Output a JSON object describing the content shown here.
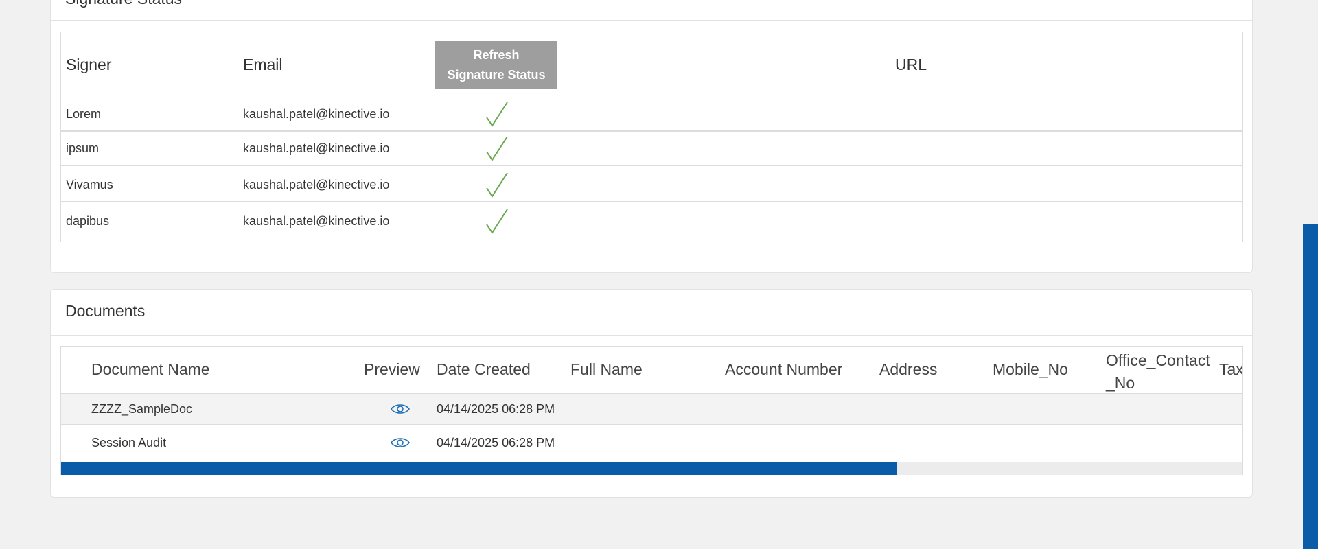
{
  "signature_status": {
    "title": "Signature Status",
    "headers": {
      "signer": "Signer",
      "email": "Email",
      "refresh_button": "Refresh\nSignature Status",
      "url": "URL"
    },
    "rows": [
      {
        "signer": "Lorem",
        "email": "kaushal.patel@kinective.io",
        "status_icon": "checkmark-icon"
      },
      {
        "signer": "ipsum",
        "email": "kaushal.patel@kinective.io",
        "status_icon": "checkmark-icon"
      },
      {
        "signer": "Vivamus",
        "email": "kaushal.patel@kinective.io",
        "status_icon": "checkmark-icon"
      },
      {
        "signer": "dapibus",
        "email": "kaushal.patel@kinective.io",
        "status_icon": "checkmark-icon"
      }
    ]
  },
  "documents": {
    "title": "Documents",
    "headers": {
      "document_name": "Document Name",
      "preview": "Preview",
      "date_created": "Date Created",
      "full_name": "Full Name",
      "account_number": "Account Number",
      "address": "Address",
      "mobile_no": "Mobile_No",
      "office_contact_no": "Office_Contact\n_No",
      "tax": "Tax"
    },
    "rows": [
      {
        "document_name": "ZZZZ_SampleDoc",
        "preview_icon": "eye-icon",
        "date_created": "04/14/2025 06:28 PM"
      },
      {
        "document_name": "Session Audit",
        "preview_icon": "eye-icon",
        "date_created": "04/14/2025 06:28 PM"
      }
    ],
    "horizontal_scroll_fraction": 0.707
  },
  "colors": {
    "accent": "#0a5ca8",
    "check": "#6aa84f",
    "button_gray": "#9e9e9e",
    "row_alt": "#f3f3f3"
  }
}
